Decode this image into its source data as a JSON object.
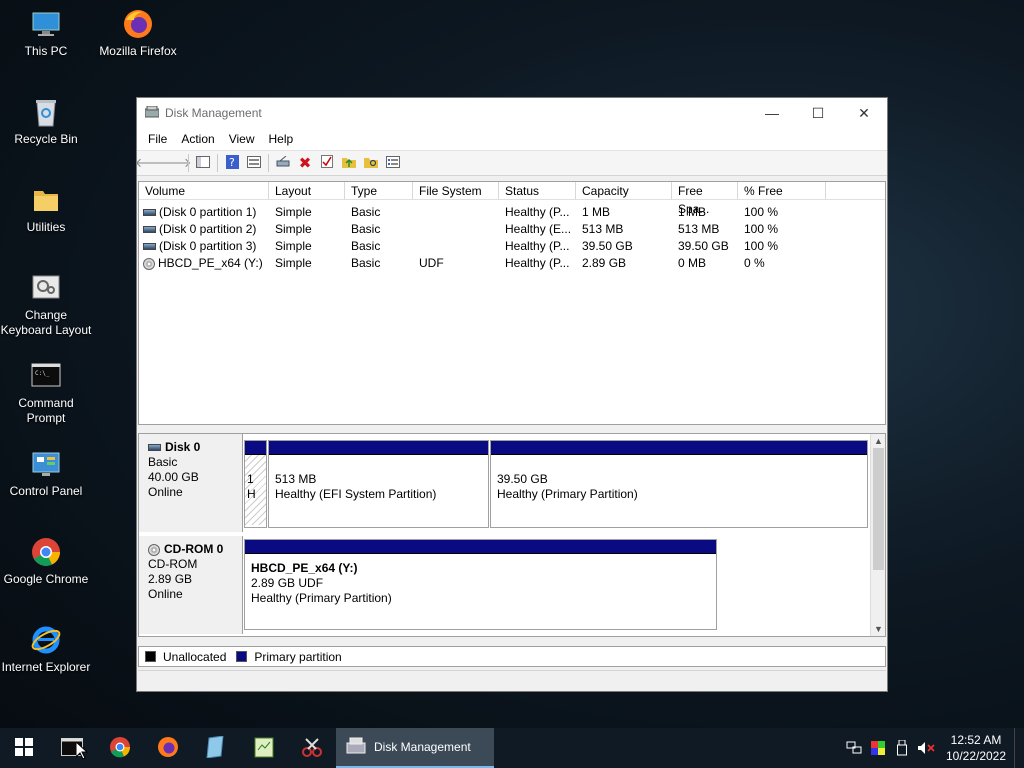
{
  "desktop": {
    "icons": [
      {
        "label": "This PC"
      },
      {
        "label": "Mozilla Firefox"
      },
      {
        "label": "Recycle Bin"
      },
      {
        "label": "Utilities"
      },
      {
        "label": "Change Keyboard Layout"
      },
      {
        "label": "Command Prompt"
      },
      {
        "label": "Control Panel"
      },
      {
        "label": "Google Chrome"
      },
      {
        "label": "Internet Explorer"
      }
    ]
  },
  "window": {
    "title": "Disk Management",
    "menu": [
      "File",
      "Action",
      "View",
      "Help"
    ],
    "columns": [
      "Volume",
      "Layout",
      "Type",
      "File System",
      "Status",
      "Capacity",
      "Free Spa...",
      "% Free"
    ],
    "volumes": [
      {
        "volume": "(Disk 0 partition 1)",
        "layout": "Simple",
        "type": "Basic",
        "fs": "",
        "status": "Healthy (P...",
        "capacity": "1 MB",
        "free": "1 MB",
        "pct": "100 %"
      },
      {
        "volume": "(Disk 0 partition 2)",
        "layout": "Simple",
        "type": "Basic",
        "fs": "",
        "status": "Healthy (E...",
        "capacity": "513 MB",
        "free": "513 MB",
        "pct": "100 %"
      },
      {
        "volume": "(Disk 0 partition 3)",
        "layout": "Simple",
        "type": "Basic",
        "fs": "",
        "status": "Healthy (P...",
        "capacity": "39.50 GB",
        "free": "39.50 GB",
        "pct": "100 %"
      },
      {
        "volume": "HBCD_PE_x64 (Y:)",
        "layout": "Simple",
        "type": "Basic",
        "fs": "UDF",
        "status": "Healthy (P...",
        "capacity": "2.89 GB",
        "free": "0 MB",
        "pct": "0 %"
      }
    ],
    "disk0": {
      "name": "Disk 0",
      "kind": "Basic",
      "size": "40.00 GB",
      "state": "Online",
      "p1": {
        "l1": "1",
        "l2": "H"
      },
      "p2": {
        "size": "513 MB",
        "status": "Healthy (EFI System Partition)"
      },
      "p3": {
        "size": "39.50 GB",
        "status": "Healthy (Primary Partition)"
      }
    },
    "cdrom0": {
      "name": "CD-ROM 0",
      "kind": "CD-ROM",
      "size": "2.89 GB",
      "state": "Online",
      "p1": {
        "label": "HBCD_PE_x64  (Y:)",
        "size": "2.89 GB UDF",
        "status": "Healthy (Primary Partition)"
      }
    },
    "legend": {
      "unallocated": "Unallocated",
      "primary": "Primary partition",
      "unallocated_color": "#000000",
      "primary_color": "#0a0a82"
    }
  },
  "taskbar": {
    "active_label": "Disk Management",
    "time": "12:52 AM",
    "date": "10/22/2022"
  }
}
